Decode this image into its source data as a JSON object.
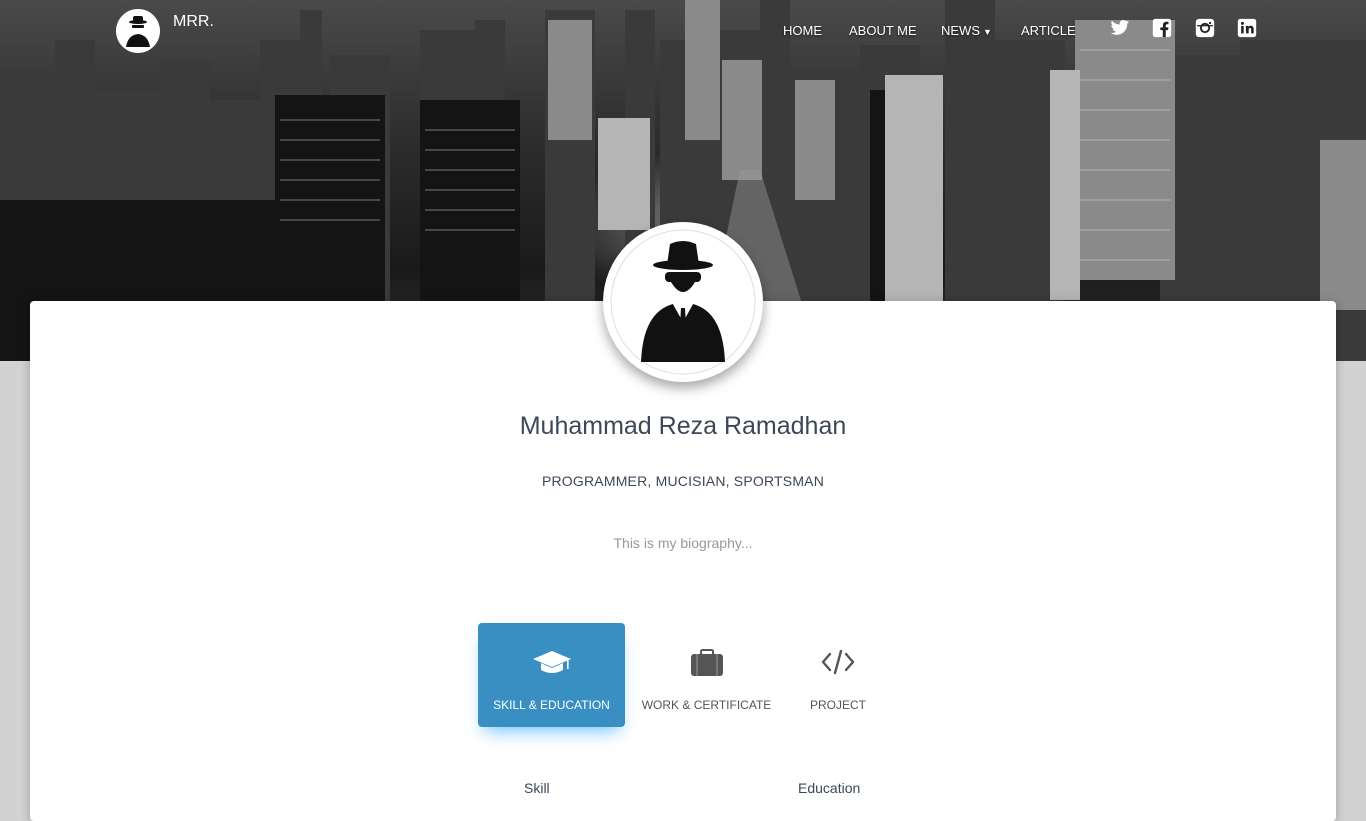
{
  "navbar": {
    "brand": "MRR.",
    "links": {
      "home": "HOME",
      "about": "ABOUT ME",
      "news": "NEWS",
      "article": "ARTICLE"
    },
    "socials": [
      "twitter-icon",
      "facebook-icon",
      "instagram-icon",
      "linkedin-icon"
    ]
  },
  "profile": {
    "name": "Muhammad Reza Ramadhan",
    "tagline": "PROGRAMMER, MUCISIAN, SPORTSMAN",
    "bio": "This is my biography..."
  },
  "tabs": [
    {
      "label": "SKILL & EDUCATION",
      "icon": "graduation-cap-icon",
      "active": true
    },
    {
      "label": "WORK & CERTIFICATE",
      "icon": "briefcase-icon",
      "active": false
    },
    {
      "label": "PROJECT",
      "icon": "code-icon",
      "active": false
    }
  ],
  "sections": {
    "skill": "Skill",
    "education": "Education"
  },
  "colors": {
    "accent": "#3a8fc2",
    "text": "#3c4858",
    "muted": "#999999"
  }
}
